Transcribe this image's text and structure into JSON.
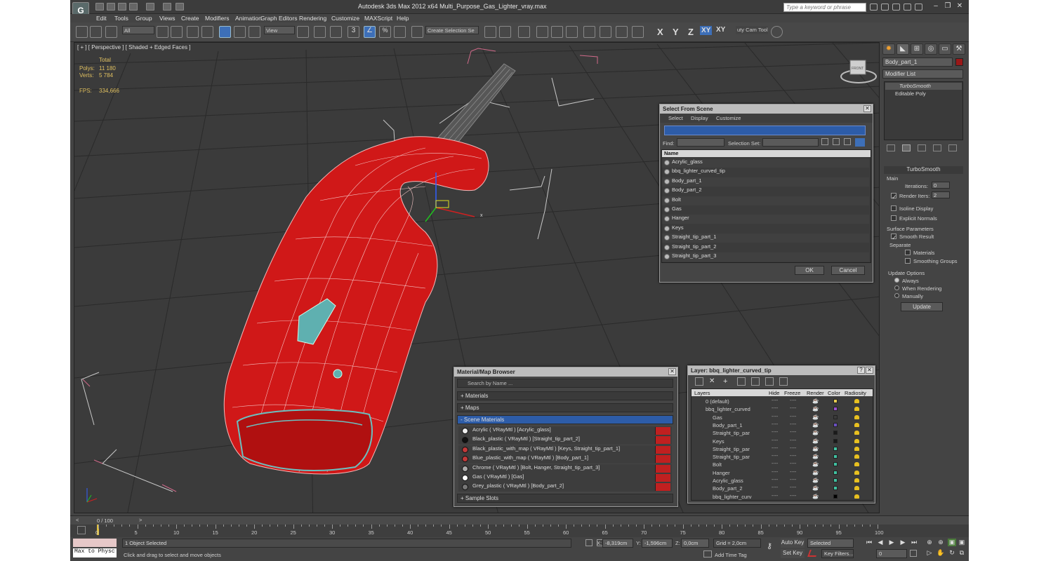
{
  "app": {
    "title": "Autodesk 3ds Max  2012 x64     Multi_Purpose_Gas_Lighter_vray.max",
    "search_placeholder": "Type a keyword or phrase",
    "logo": "3ds-max-logo-icon"
  },
  "menus": [
    "Edit",
    "Tools",
    "Group",
    "Views",
    "Create",
    "Modifiers",
    "Animation",
    "Graph Editors",
    "Rendering",
    "Customize",
    "MAXScript",
    "Help"
  ],
  "toolbar": {
    "selection_filter": "All",
    "ref_coord": "View",
    "named_selection": "Create Selection Se",
    "snap_label": "3",
    "angle_snap": "∠",
    "percent_snap": "%",
    "axis_x": "X",
    "axis_y": "Y",
    "axis_z": "Z",
    "axis_xy": "XY",
    "axis_xy2": "XY",
    "utility_label": "uty Cam Tool"
  },
  "viewport": {
    "label": "[ + ] [ Perspective ] [ Shaded + Edged Faces ]",
    "stats": {
      "total_label": "Total",
      "polys_label": "Polys:",
      "polys_value": "11 180",
      "verts_label": "Verts:",
      "verts_value": "5 784",
      "fps_label": "FPS:",
      "fps_value": "334,666"
    },
    "gizmo_x": "x",
    "viewcube_label": "FRONT"
  },
  "select_from_scene": {
    "title": "Select From Scene",
    "menus": [
      "Select",
      "Display",
      "Customize"
    ],
    "find_label": "Find:",
    "selection_set_label": "Selection Set:",
    "column_header": "Name",
    "items": [
      "Acrylic_glass",
      "bbq_lighter_curved_tip",
      "Body_part_1",
      "Body_part_2",
      "Bolt",
      "Gas",
      "Hanger",
      "Keys",
      "Straight_tip_part_1",
      "Straight_tip_part_2",
      "Straight_tip_part_3"
    ],
    "ok": "OK",
    "cancel": "Cancel"
  },
  "material_browser": {
    "title": "Material/Map Browser",
    "search_placeholder": "Search by Name ...",
    "sections": {
      "materials": "+ Materials",
      "maps": "+ Maps",
      "scene_materials": "- Scene Materials",
      "sample_slots": "+ Sample Slots"
    },
    "items": [
      {
        "label": "Acrylic  ( VRayMtl )  [Acrylic_glass]",
        "swatch": "#eeeeee"
      },
      {
        "label": "Black_plastic  ( VRayMtl )  [Straight_tip_part_2]",
        "swatch": "#111111"
      },
      {
        "label": "Black_plastic_with_map  ( VRayMtl )  [Keys, Straight_tip_part_1]",
        "swatch": "#c03a3a"
      },
      {
        "label": "Blue_plastic_with_map  ( VRayMtl )  [Body_part_1]",
        "swatch": "#c03a3a"
      },
      {
        "label": "Chrome  ( VRayMtl )  [Bolt, Hanger, Straight_tip_part_3]",
        "swatch": "#aaaaaa"
      },
      {
        "label": "Gas  ( VRayMtl )  [Gas]",
        "swatch": "#ffffff"
      },
      {
        "label": "Grey_plastic  ( VRayMtl )  [Body_part_2]",
        "swatch": "#777777"
      }
    ]
  },
  "layer_dialog": {
    "title": "Layer: bbq_lighter_curved_tip",
    "columns": [
      "Layers",
      "Hide",
      "Freeze",
      "Render",
      "Color",
      "Radiosity"
    ],
    "rows": [
      {
        "name": "0 (default)",
        "indent": 1,
        "color": "#e6cc50"
      },
      {
        "name": "bbq_lighter_curved",
        "indent": 1,
        "color": "#9a50d0"
      },
      {
        "name": "Gas",
        "indent": 2,
        "color": "#3a3a3a"
      },
      {
        "name": "Body_part_1",
        "indent": 2,
        "color": "#6a50c0"
      },
      {
        "name": "Straight_tip_par",
        "indent": 2,
        "color": "#1a1a1a"
      },
      {
        "name": "Keys",
        "indent": 2,
        "color": "#1a1a1a"
      },
      {
        "name": "Straight_tip_par",
        "indent": 2,
        "color": "#40c0a0"
      },
      {
        "name": "Straight_tip_par",
        "indent": 2,
        "color": "#40c0a0"
      },
      {
        "name": "Bolt",
        "indent": 2,
        "color": "#40c0a0"
      },
      {
        "name": "Hanger",
        "indent": 2,
        "color": "#40c0a0"
      },
      {
        "name": "Acrylic_glass",
        "indent": 2,
        "color": "#40c0a0"
      },
      {
        "name": "Body_part_2",
        "indent": 2,
        "color": "#40c0a0"
      },
      {
        "name": "bbq_lighter_curv",
        "indent": 2,
        "color": "#000000"
      }
    ],
    "dash": "----"
  },
  "command_panel": {
    "object_name": "Body_part_1",
    "modifier_list": "Modifier List",
    "stack": [
      "TurboSmooth",
      "Editable Poly"
    ],
    "turbosmooth": {
      "title": "TurboSmooth",
      "main_label": "Main",
      "iterations_label": "Iterations:",
      "iterations_value": "0",
      "render_iters_label": "Render Iters:",
      "render_iters_value": "2",
      "isoline_label": "Isoline Display",
      "explicit_normals_label": "Explicit Normals",
      "surface_params_label": "Surface Parameters",
      "smooth_result_label": "Smooth Result",
      "separate_label": "Separate",
      "materials_label": "Materials",
      "smoothing_groups_label": "Smoothing Groups",
      "update_options_label": "Update Options",
      "always_label": "Always",
      "when_rendering_label": "When Rendering",
      "manually_label": "Manually",
      "update_button": "Update"
    }
  },
  "timeline": {
    "frame_label": "0 / 100",
    "ticks": [
      "0",
      "5",
      "10",
      "15",
      "20",
      "25",
      "30",
      "35",
      "40",
      "45",
      "50",
      "55",
      "60",
      "65",
      "70",
      "75",
      "80",
      "85",
      "90",
      "95",
      "100"
    ]
  },
  "status": {
    "maxscript_label": "Max to Physc",
    "selected_text": "1 Object Selected",
    "prompt_text": "Click and drag to select and move objects",
    "x_label": "X:",
    "x_value": "-8,319cm",
    "y_label": "Y:",
    "y_value": "-1,596cm",
    "z_label": "Z:",
    "z_value": "0,0cm",
    "grid": "Grid = 2,0cm",
    "add_time_tag": "Add Time Tag",
    "auto_key": "Auto Key",
    "set_key": "Set Key",
    "key_mode": "Selected",
    "key_filters": "Key Filters...",
    "current_frame": "0"
  },
  "colors": {
    "accent": "#3d6fb8",
    "model_red": "#d01818",
    "ui_bg": "#444444"
  }
}
